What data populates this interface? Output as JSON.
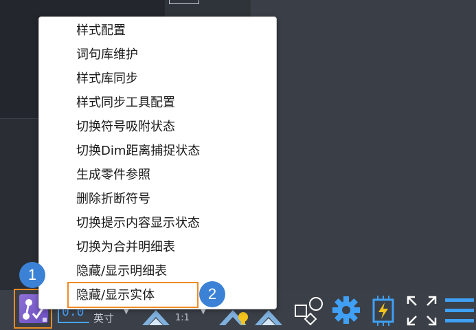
{
  "menu": {
    "items": [
      {
        "label": "样式配置"
      },
      {
        "label": "词句库维护"
      },
      {
        "label": "样式库同步"
      },
      {
        "label": "样式同步工具配置"
      },
      {
        "label": "切换符号吸附状态"
      },
      {
        "label": "切换Dim距离捕捉状态"
      },
      {
        "label": "生成零件参照"
      },
      {
        "label": "删除折断符号"
      },
      {
        "label": "切换提示内容显示状态"
      },
      {
        "label": "切换为合并明细表"
      },
      {
        "label": "隐藏/显示明细表"
      },
      {
        "label": "隐藏/显示实体"
      }
    ]
  },
  "statusbar": {
    "scale_value": "0.0",
    "unit_label": "英寸",
    "ratio_label": "1:1"
  },
  "badges": {
    "step1": "1",
    "step2": "2"
  },
  "colors": {
    "highlight": "#f08a24",
    "badge": "#3b82d6",
    "accent_blue": "#4aa3ff"
  }
}
